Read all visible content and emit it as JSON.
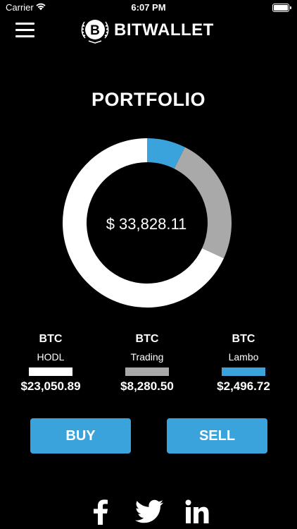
{
  "status_bar": {
    "carrier": "Carrier",
    "time": "6:07 PM"
  },
  "header": {
    "brand_name": "BITWALLET",
    "logo_glyph": "B",
    "menu_icon": "hamburger-menu-icon"
  },
  "portfolio": {
    "title": "PORTFOLIO",
    "total": "$ 33,828.11"
  },
  "chart_data": {
    "type": "pie",
    "title": "PORTFOLIO",
    "categories": [
      "HODL",
      "Trading",
      "Lambo"
    ],
    "values": [
      23050.89,
      8280.5,
      2496.72
    ],
    "colors": [
      "#ffffff",
      "#a9a9a9",
      "#3aa3dc"
    ]
  },
  "legend": [
    {
      "coin": "BTC",
      "label": "HODL",
      "amount": "$23,050.89",
      "color": "#ffffff"
    },
    {
      "coin": "BTC",
      "label": "Trading",
      "amount": "$8,280.50",
      "color": "#a9a9a9"
    },
    {
      "coin": "BTC",
      "label": "Lambo",
      "amount": "$2,496.72",
      "color": "#3aa3dc"
    }
  ],
  "actions": {
    "buy_label": "BUY",
    "sell_label": "SELL"
  },
  "social": [
    "facebook-icon",
    "twitter-icon",
    "linkedin-icon"
  ],
  "colors": {
    "accent": "#3aa3dc",
    "background": "#000000"
  }
}
